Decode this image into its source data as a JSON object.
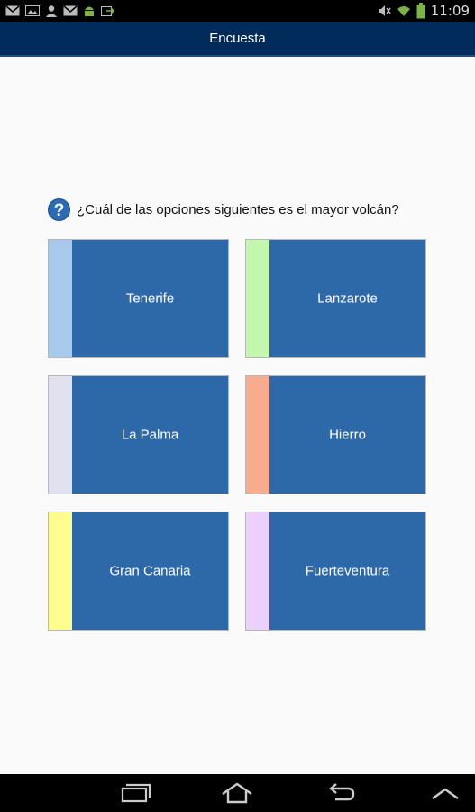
{
  "status_bar": {
    "time": "11:09",
    "left_icons": [
      "gmail-icon",
      "gallery-icon",
      "contact-icon",
      "gmail-icon",
      "android-icon",
      "sync-icon"
    ],
    "right_icons": [
      "mute-icon",
      "wifi-icon",
      "battery-icon"
    ]
  },
  "app_bar": {
    "title": "Encuesta"
  },
  "question": {
    "text": "¿Cuál de las opciones siguientes es el mayor volcán?",
    "icon": "help-icon"
  },
  "options": [
    {
      "label": "Tenerife",
      "color": "#a9c9ec"
    },
    {
      "label": "Lanzarote",
      "color": "#c4f7ae"
    },
    {
      "label": "La Palma",
      "color": "#e1e1f0"
    },
    {
      "label": "Hierro",
      "color": "#f7ac8e"
    },
    {
      "label": "Gran Canaria",
      "color": "#fdfd8f"
    },
    {
      "label": "Fuerteventura",
      "color": "#ebd0fb"
    }
  ],
  "colors": {
    "app_bar": "#002b5a",
    "option_bg": "#2d69a9"
  }
}
